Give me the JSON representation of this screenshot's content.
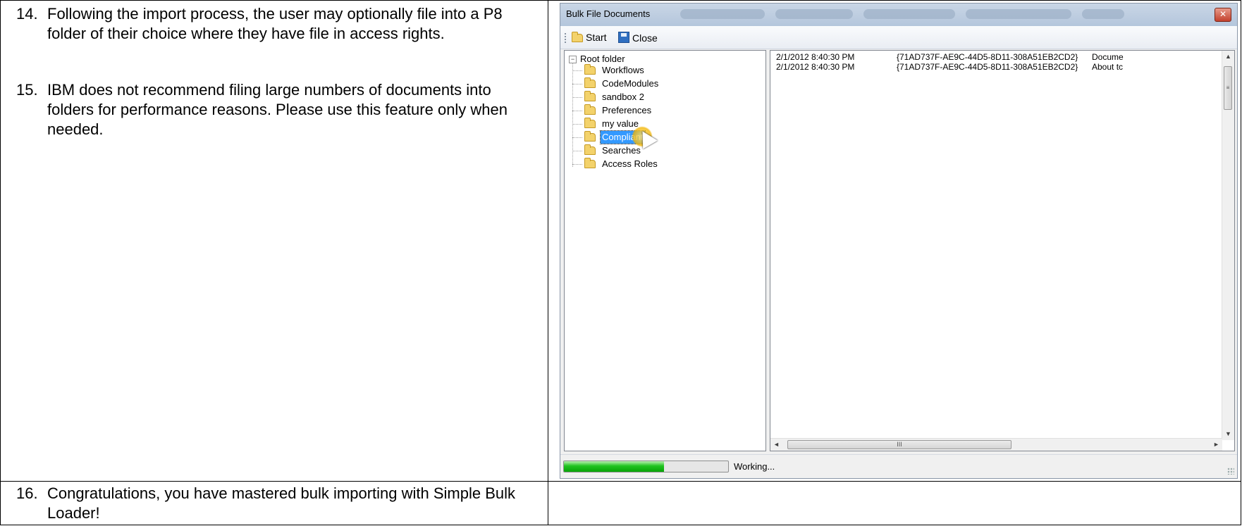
{
  "steps": [
    {
      "num": "14.",
      "text": "Following the import process, the user may optionally file into a P8 folder of their choice where they have file in access rights."
    },
    {
      "num": "15.",
      "text": "IBM does not recommend filing large numbers of documents into folders for performance reasons. Please use this feature only when needed."
    },
    {
      "num": "16.",
      "text": "Congratulations, you have mastered bulk importing with Simple Bulk Loader!"
    }
  ],
  "window": {
    "title": "Bulk File Documents",
    "close_glyph": "✕",
    "toolbar": {
      "start_label": "Start",
      "close_label": "Close"
    },
    "tree": {
      "root_label": "Root folder",
      "expander_glyph": "−",
      "folders": [
        "Workflows",
        "CodeModules",
        "sandbox 2",
        "Preferences",
        "my value",
        "Compliant",
        "Searches",
        "Access Roles"
      ],
      "selected": "Compliant"
    },
    "log": [
      {
        "date": "2/1/2012 8:40:30 PM",
        "guid": "{71AD737F-AE9C-44D5-8D11-308A51EB2CD2}",
        "message": "Docume"
      },
      {
        "date": "2/1/2012 8:40:30 PM",
        "guid": "{71AD737F-AE9C-44D5-8D11-308A51EB2CD2}",
        "message": "About tc"
      }
    ],
    "scroll_glyphs": {
      "up": "▲",
      "down": "▼",
      "left": "◄",
      "right": "►",
      "vthumb": "≡",
      "hthumb": "III"
    },
    "status": {
      "text": "Working...",
      "progress": 0.61
    }
  },
  "colors": {
    "progress_green": "#1fc31f",
    "selection_blue": "#3399ff",
    "titlebar": "#b4c6dc"
  }
}
